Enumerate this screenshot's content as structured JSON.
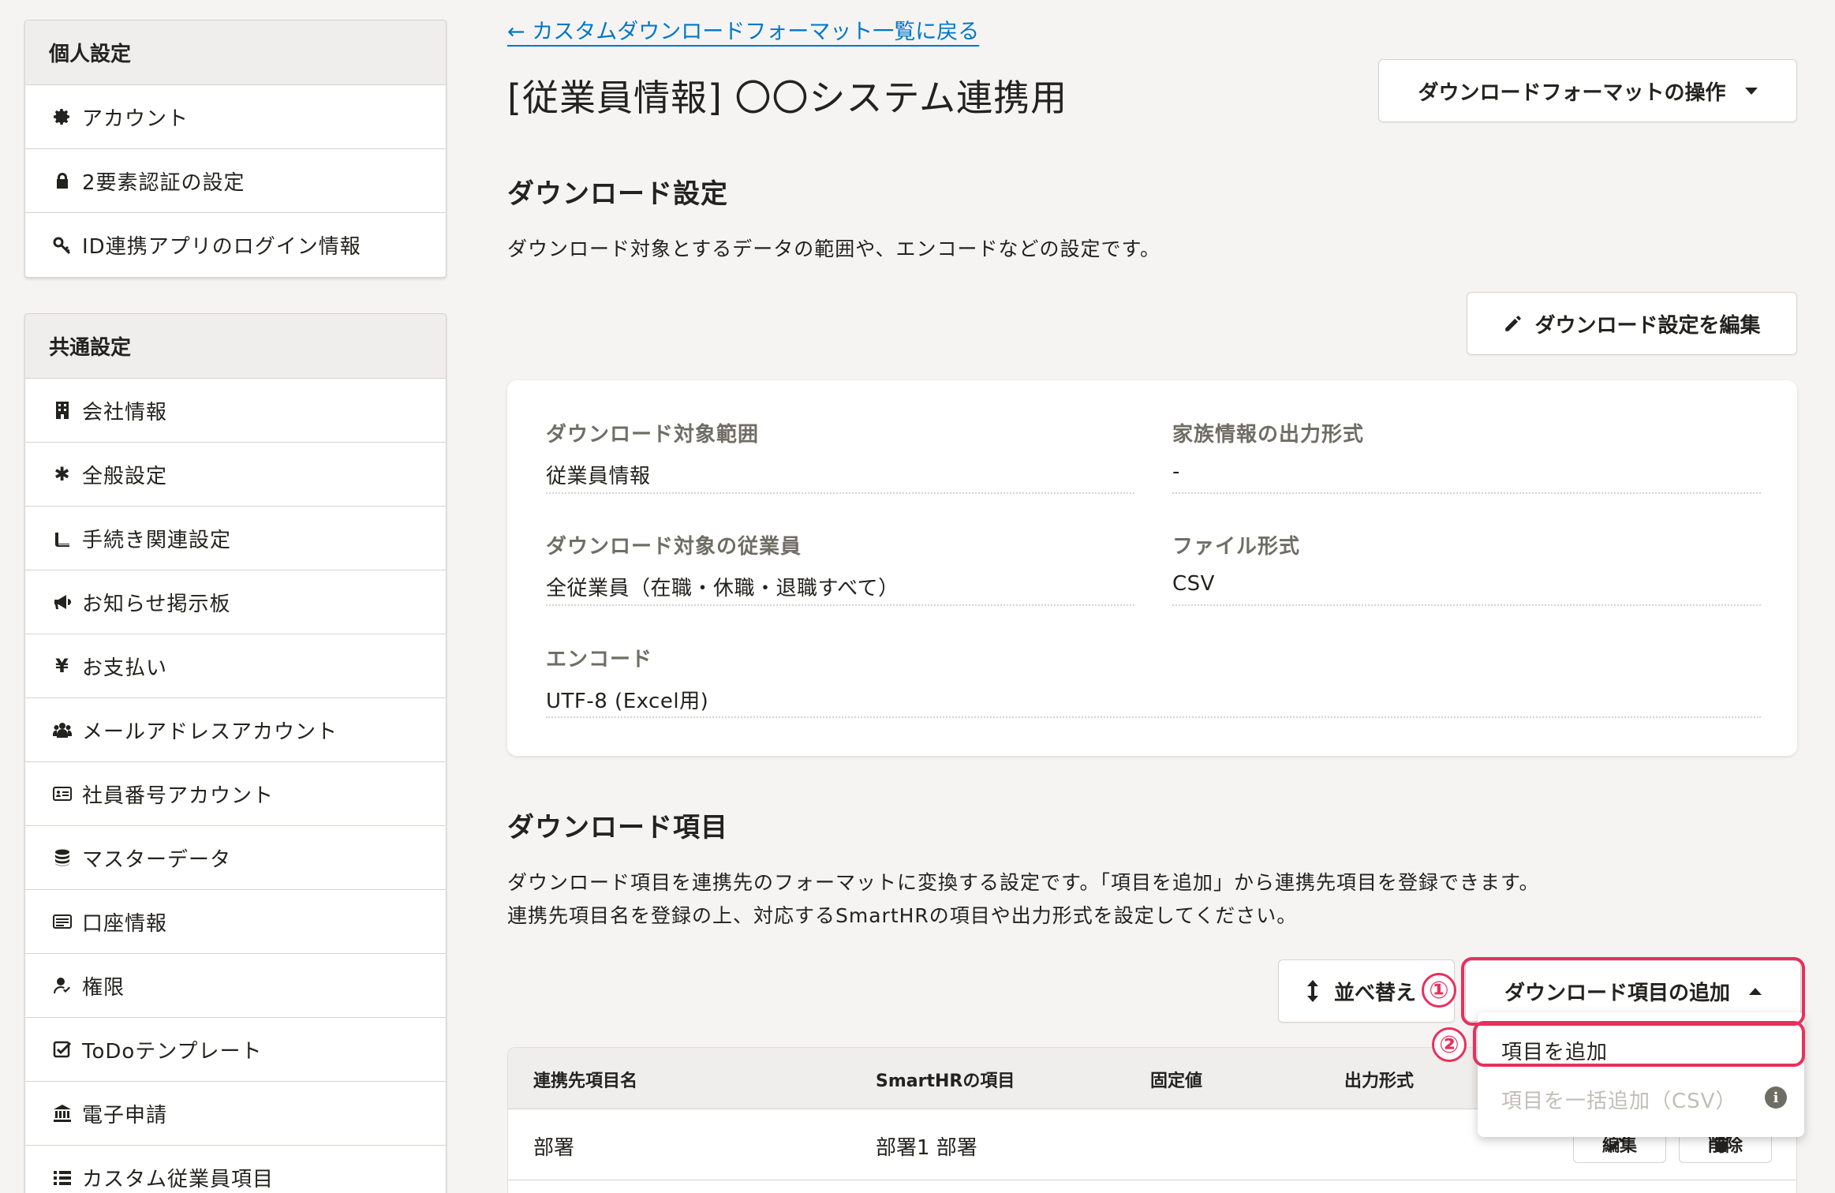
{
  "sidebar": {
    "personal": {
      "title": "個人設定",
      "items": [
        {
          "label": "アカウント",
          "icon": "gear-icon"
        },
        {
          "label": "2要素認証の設定",
          "icon": "lock-icon"
        },
        {
          "label": "ID連携アプリのログイン情報",
          "icon": "key-icon"
        }
      ]
    },
    "common": {
      "title": "共通設定",
      "items": [
        {
          "label": "会社情報",
          "icon": "building-icon"
        },
        {
          "label": "全般設定",
          "icon": "asterisk-icon"
        },
        {
          "label": "手続き関連設定",
          "icon": "book-icon"
        },
        {
          "label": "お知らせ掲示板",
          "icon": "megaphone-icon"
        },
        {
          "label": "お支払い",
          "icon": "yen-icon"
        },
        {
          "label": "メールアドレスアカウント",
          "icon": "users-icon"
        },
        {
          "label": "社員番号アカウント",
          "icon": "id-card-icon"
        },
        {
          "label": "マスターデータ",
          "icon": "database-icon"
        },
        {
          "label": "口座情報",
          "icon": "bank-card-icon"
        },
        {
          "label": "権限",
          "icon": "user-check-icon"
        },
        {
          "label": "ToDoテンプレート",
          "icon": "checkbox-icon"
        },
        {
          "label": "電子申請",
          "icon": "government-icon"
        },
        {
          "label": "カスタム従業員項目",
          "icon": "list-icon"
        }
      ]
    }
  },
  "main": {
    "back_link": "カスタムダウンロードフォーマット一覧に戻る",
    "title": "[従業員情報] 〇〇システム連携用",
    "operations_button": "ダウンロードフォーマットの操作",
    "download_settings": {
      "heading": "ダウンロード設定",
      "description": "ダウンロード対象とするデータの範囲や、エンコードなどの設定です。",
      "edit_button": "ダウンロード設定を編集",
      "fields": {
        "target_range": {
          "label": "ダウンロード対象範囲",
          "value": "従業員情報"
        },
        "family_format": {
          "label": "家族情報の出力形式",
          "value": "-"
        },
        "target_employees": {
          "label": "ダウンロード対象の従業員",
          "value": "全従業員（在職・休職・退職すべて）"
        },
        "file_format": {
          "label": "ファイル形式",
          "value": "CSV"
        },
        "encode": {
          "label": "エンコード",
          "value": "UTF-8 (Excel用)"
        }
      }
    },
    "download_items": {
      "heading": "ダウンロード項目",
      "description_line1": "ダウンロード項目を連携先のフォーマットに変換する設定です。「項目を追加」から連携先項目を登録できます。",
      "description_line2": "連携先項目名を登録の上、対応するSmartHRの項目や出力形式を設定してください。",
      "sort_button": "並べ替え",
      "add_button": "ダウンロード項目の追加",
      "dropdown": {
        "add_item": "項目を追加",
        "bulk_add": "項目を一括追加（CSV）"
      },
      "table": {
        "columns": [
          "連携先項目名",
          "SmartHRの項目",
          "固定値",
          "出力形式"
        ],
        "rows": [
          {
            "name": "部署",
            "smarthr_item": "部署1 部署",
            "fixed": "",
            "format": ""
          }
        ],
        "edit_button": "編集",
        "delete_button": "削除"
      }
    },
    "annotations": {
      "step1": "①",
      "step2": "②"
    }
  },
  "colors": {
    "link": "#0077c7",
    "highlight": "#e8305c",
    "background": "#f5f4f3",
    "header_bg": "#efeeec"
  }
}
